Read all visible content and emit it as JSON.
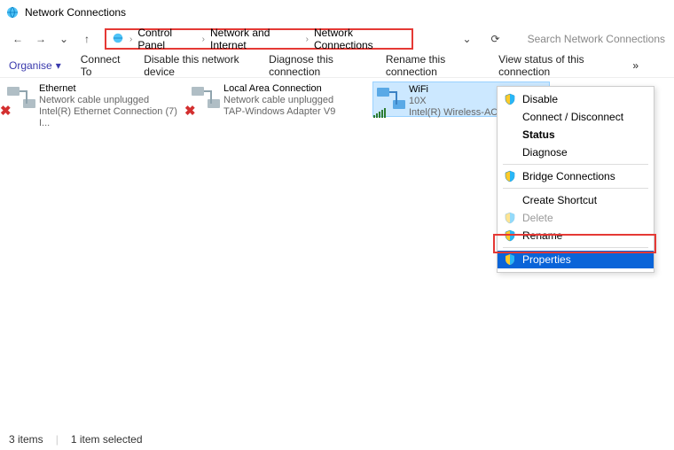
{
  "window": {
    "title": "Network Connections"
  },
  "breadcrumb": {
    "root": "Control Panel",
    "mid": "Network and Internet",
    "leaf": "Network Connections"
  },
  "search": {
    "placeholder": "Search Network Connections"
  },
  "toolbar": {
    "organise": "Organise",
    "connect_to": "Connect To",
    "disable": "Disable this network device",
    "diagnose": "Diagnose this connection",
    "rename": "Rename this connection",
    "view_status": "View status of this connection",
    "more": "»"
  },
  "adapters": [
    {
      "name": "Ethernet",
      "status": "Network cable unplugged",
      "device": "Intel(R) Ethernet Connection (7) I...",
      "disconnected": true
    },
    {
      "name": "Local Area Connection",
      "status": "Network cable unplugged",
      "device": "TAP-Windows Adapter V9",
      "disconnected": true
    },
    {
      "name": "WiFi",
      "status": "10X",
      "device": "Intel(R) Wireless-AC",
      "disconnected": false
    }
  ],
  "context_menu": {
    "disable": "Disable",
    "connect": "Connect / Disconnect",
    "status": "Status",
    "diagnose": "Diagnose",
    "bridge": "Bridge Connections",
    "shortcut": "Create Shortcut",
    "delete": "Delete",
    "rename": "Rename",
    "properties": "Properties"
  },
  "statusbar": {
    "items": "3 items",
    "selected": "1 item selected"
  },
  "icons": {
    "back": "←",
    "forward": "→",
    "recent": "⌄",
    "up": "↑",
    "dropdown": "⌄",
    "refresh": "⟳",
    "chevron": "▾",
    "redx": "✖"
  }
}
